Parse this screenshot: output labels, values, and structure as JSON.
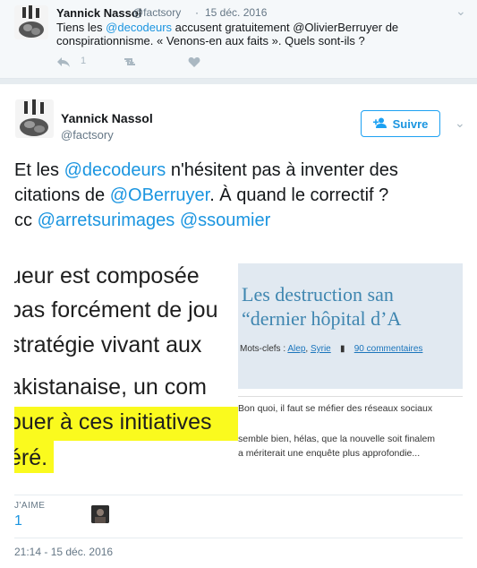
{
  "parent_tweet": {
    "author_name": "Yannick Nassol",
    "handle": "@factsory",
    "separator": "·",
    "date": "15 déc. 2016",
    "text_before": "Tiens les ",
    "mention_1": "@decodeurs",
    "text_middle": " accusent gratuitement ",
    "mention_2": "@OlivierBerruyer",
    "text_after": " de conspirationnisme. « Venons-en aux faits ». Quels sont-ils ?",
    "reply_count": "1"
  },
  "main_tweet": {
    "author_name": "Yannick Nassol",
    "handle": "@factsory",
    "follow_label": "Suivre",
    "text_1": "Et les ",
    "mention_1": "@decodeurs",
    "text_2": " n'hésitent pas à inventer des citations de ",
    "mention_2": "@OBerruyer",
    "text_3": ". À quand le correctif ?",
    "text_4": "cc ",
    "mention_3": "@arretsurimages",
    "mention_4": "@ssoumier"
  },
  "media": {
    "left_lines": [
      "ueur est composée",
      "bas forcément de jou",
      " stratégie vivant aux",
      "akistanaise, un com",
      "ouer à ces initiatives",
      "éré."
    ],
    "right_title_1": "Les destruction san",
    "right_title_2": "“dernier hôpital d’A",
    "tags_label": "Mots-clefs : ",
    "tag_1": "Alep",
    "tag_sep": ", ",
    "tag_2": "Syrie",
    "comments": "90 commentaires",
    "body_1": "Bon quoi, il faut se méfier des réseaux sociaux",
    "body_2": "semble bien, hélas, que la nouvelle soit finalem",
    "body_3": "a mériterait une enquête plus approfondie..."
  },
  "stats": {
    "likes_label": "J'AIME",
    "likes_count": "1"
  },
  "timestamp": "21:14 - 15 déc. 2016"
}
